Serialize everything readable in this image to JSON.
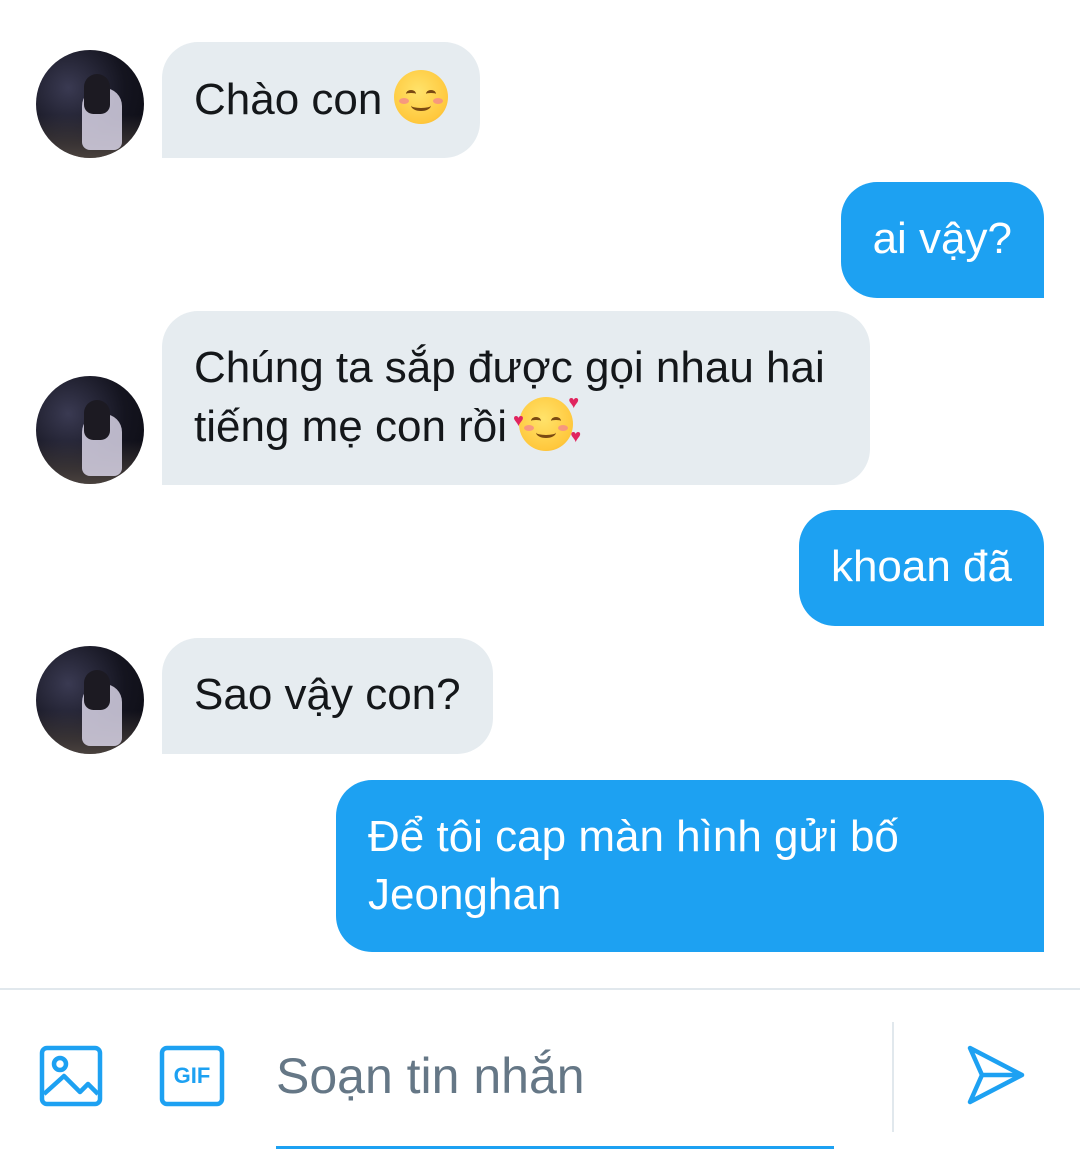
{
  "conversation": {
    "messages": [
      {
        "direction": "incoming",
        "text": "Chào con",
        "emoji": "smiling-face-icon"
      },
      {
        "direction": "outgoing",
        "text": "ai vậy?"
      },
      {
        "direction": "incoming",
        "text": "Chúng ta sắp được gọi nhau hai tiếng mẹ con rồi",
        "emoji": "smiling-face-with-hearts-icon"
      },
      {
        "direction": "outgoing",
        "text": "khoan đã"
      },
      {
        "direction": "incoming",
        "text": "Sao vậy con?"
      },
      {
        "direction": "outgoing",
        "text": "Để tôi cap màn hình gửi bố Jeonghan"
      }
    ]
  },
  "composer": {
    "placeholder": "Soạn tin nhắn",
    "gif_label": "GIF",
    "icons": [
      "image-icon",
      "gif-icon",
      "send-icon"
    ]
  },
  "colors": {
    "accent": "#1da1f2",
    "incoming_bubble": "#e6ecf0",
    "incoming_text": "#14171a",
    "outgoing_text": "#ffffff",
    "placeholder": "#657786",
    "divider": "#e1e8ed"
  }
}
